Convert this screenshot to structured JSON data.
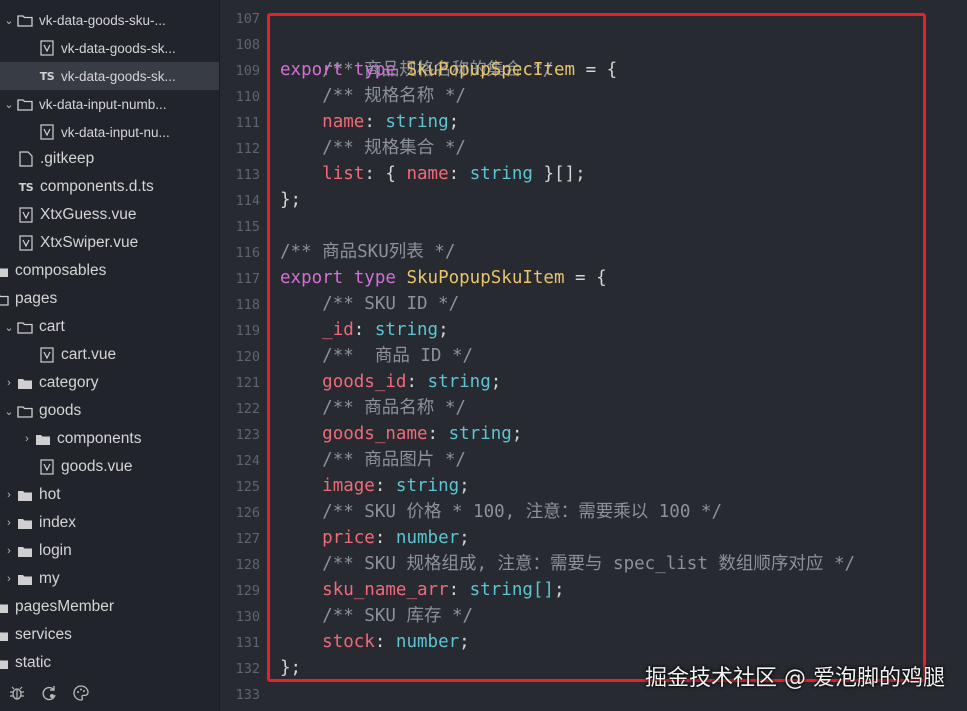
{
  "sidebar": {
    "items": [
      {
        "label": "vk-data-goods-sku-...",
        "type": "folder",
        "expanded": true
      },
      {
        "label": "vk-data-goods-sk...",
        "type": "vue"
      },
      {
        "label": "vk-data-goods-sk...",
        "type": "ts",
        "selected": true
      },
      {
        "label": "vk-data-input-numb...",
        "type": "folder",
        "expanded": true
      },
      {
        "label": "vk-data-input-nu...",
        "type": "vue"
      },
      {
        "label": ".gitkeep",
        "type": "file"
      },
      {
        "label": "components.d.ts",
        "type": "ts"
      },
      {
        "label": "XtxGuess.vue",
        "type": "vue"
      },
      {
        "label": "XtxSwiper.vue",
        "type": "vue"
      },
      {
        "label": "composables",
        "type": "folder"
      },
      {
        "label": "pages",
        "type": "folder"
      },
      {
        "label": "cart",
        "type": "folder",
        "expanded": true
      },
      {
        "label": "cart.vue",
        "type": "vue"
      },
      {
        "label": "category",
        "type": "folder",
        "expanded": false
      },
      {
        "label": "goods",
        "type": "folder",
        "expanded": true
      },
      {
        "label": "components",
        "type": "folder",
        "expanded": false
      },
      {
        "label": "goods.vue",
        "type": "vue"
      },
      {
        "label": "hot",
        "type": "folder",
        "expanded": false
      },
      {
        "label": "index",
        "type": "folder",
        "expanded": false
      },
      {
        "label": "login",
        "type": "folder",
        "expanded": false
      },
      {
        "label": "my",
        "type": "folder",
        "expanded": false
      },
      {
        "label": "pagesMember",
        "type": "folder"
      },
      {
        "label": "services",
        "type": "folder"
      },
      {
        "label": "static",
        "type": "folder"
      }
    ],
    "bottom_icons": [
      "bug-icon",
      "sync-icon",
      "palette-icon"
    ]
  },
  "editor": {
    "line_numbers": [
      "107",
      "108",
      "109",
      "110",
      "111",
      "112",
      "113",
      "114",
      "115",
      "116",
      "117",
      "118",
      "119",
      "120",
      "121",
      "122",
      "123",
      "124",
      "125",
      "126",
      "127",
      "128",
      "129",
      "130",
      "131",
      "132",
      "133"
    ],
    "lines": {
      "l108": "/** 商品规格名称的集合 */",
      "l109_kw1": "export",
      "l109_kw2": "type",
      "l109_name": "SkuPopupSpecItem",
      "l109_rest": " = {",
      "l110": "/** 规格名称 */",
      "l111_prop": "name",
      "l111_type": "string",
      "l112": "/** 规格集合 */",
      "l113_prop": "list",
      "l113_inner_prop": "name",
      "l113_type": "string",
      "l114": "};",
      "l116": "/** 商品SKU列表 */",
      "l117_kw1": "export",
      "l117_kw2": "type",
      "l117_name": "SkuPopupSkuItem",
      "l117_rest": " = {",
      "l118": "/** SKU ID */",
      "l119_prop": "_id",
      "l119_type": "string",
      "l120": "/**  商品 ID */",
      "l121_prop": "goods_id",
      "l121_type": "string",
      "l122": "/** 商品名称 */",
      "l123_prop": "goods_name",
      "l123_type": "string",
      "l124": "/** 商品图片 */",
      "l125_prop": "image",
      "l125_type": "string",
      "l126": "/** SKU 价格 * 100, 注意：需要乘以 100 */",
      "l127_prop": "price",
      "l127_type": "number",
      "l128": "/** SKU 规格组成, 注意：需要与 spec_list 数组顺序对应 */",
      "l129_prop": "sku_name_arr",
      "l129_type": "string[]",
      "l130": "/** SKU 库存 */",
      "l131_prop": "stock",
      "l131_type": "number",
      "l132": "};"
    }
  },
  "watermark": "掘金技术社区 @ 爱泡脚的鸡腿",
  "colors": {
    "highlight_border": "#e8202a",
    "keyword": "#d46fd8",
    "type_name": "#e9c46a",
    "property": "#f06b78",
    "primitive_type": "#5ec4d4",
    "comment": "#8b929c"
  }
}
